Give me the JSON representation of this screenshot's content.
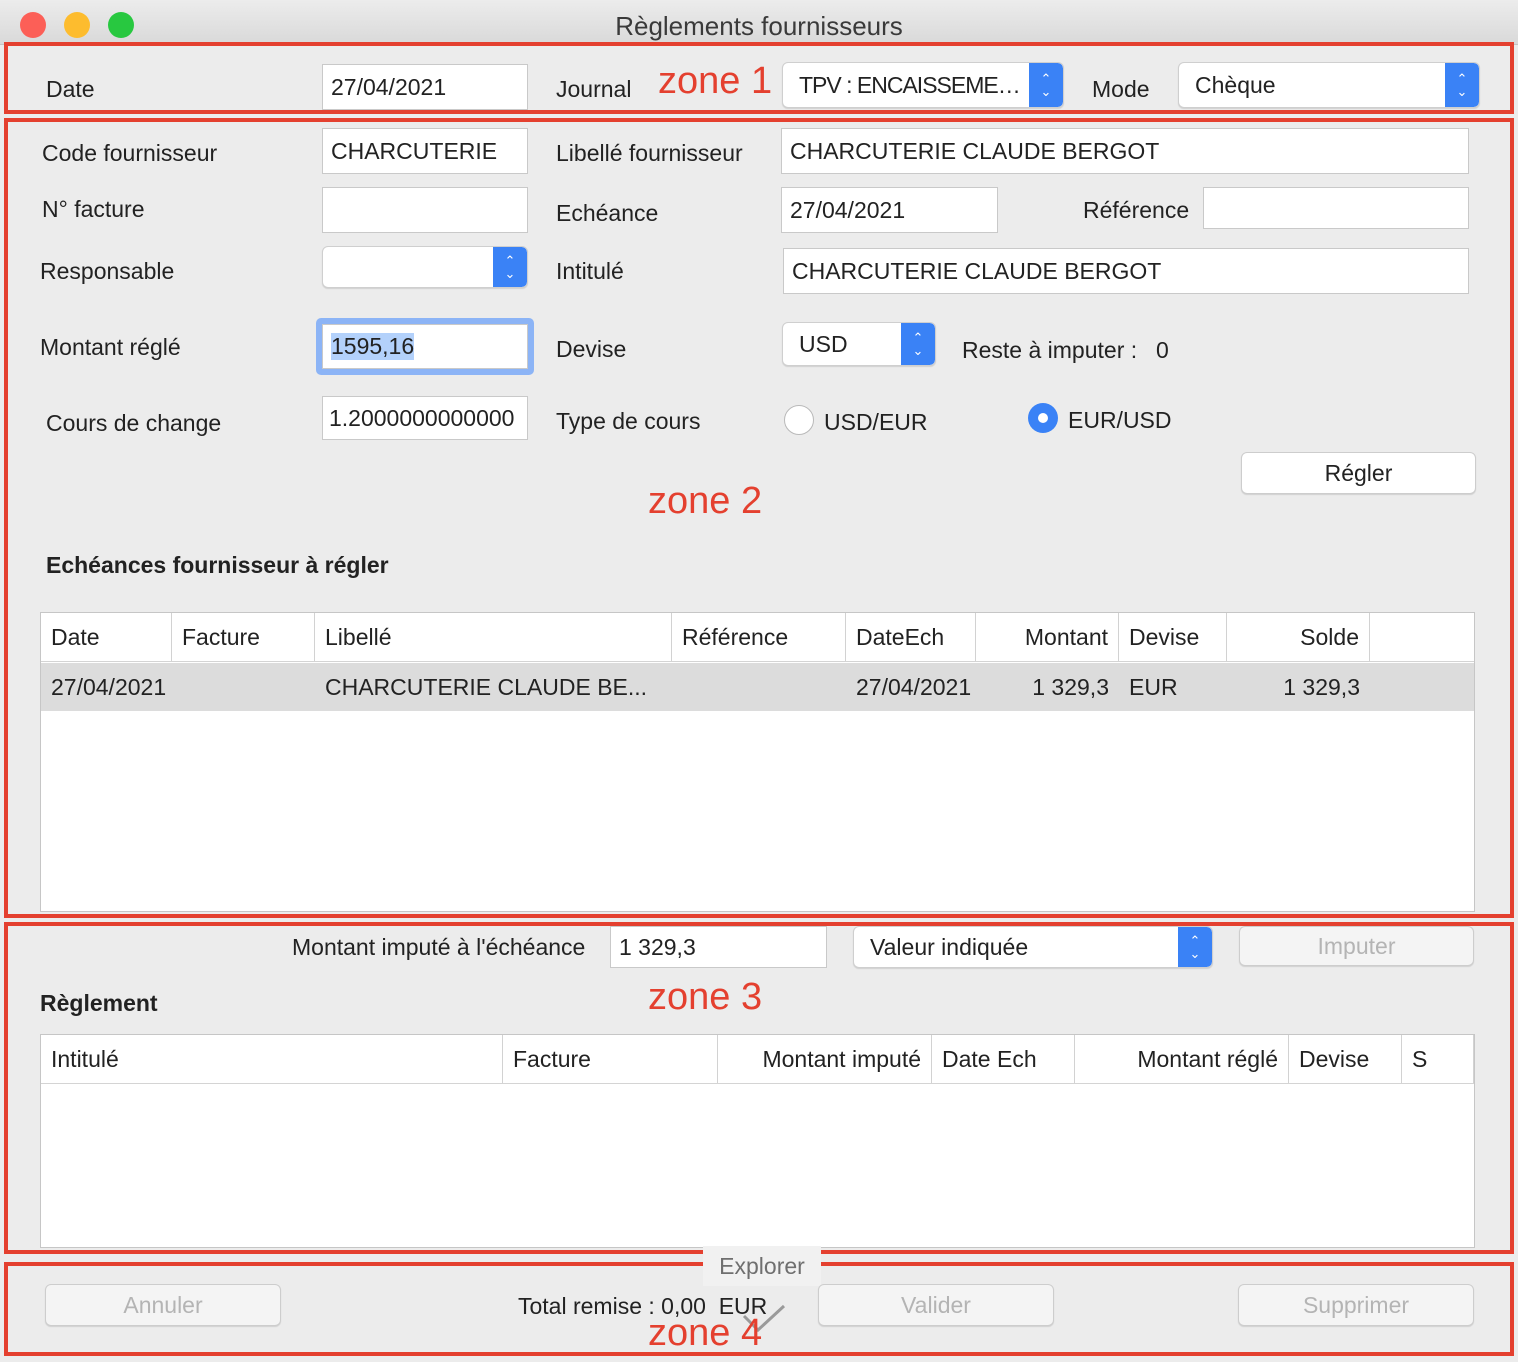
{
  "window": {
    "title": "Règlements fournisseurs",
    "traffic_lights": {
      "close": "#fc5f57",
      "minimize": "#fdbc2e",
      "zoom": "#28c840"
    }
  },
  "zone_labels": {
    "z1": "zone 1",
    "z2": "zone 2",
    "z3": "zone 3",
    "z4": "zone 4"
  },
  "accent_colors": {
    "zone_border": "#e4402f",
    "selection": "#3a82f6"
  },
  "zone1": {
    "date_label": "Date",
    "date_value": "27/04/2021",
    "journal_label": "Journal",
    "journal_value": "TPV : ENCAISSEME…",
    "mode_label": "Mode",
    "mode_value": "Chèque"
  },
  "zone2": {
    "code_label": "Code fournisseur",
    "code_value": "CHARCUTERIE",
    "libelle_label": "Libellé fournisseur",
    "libelle_value": "CHARCUTERIE CLAUDE BERGOT",
    "facture_label": "N° facture",
    "facture_value": "",
    "echeance_label": "Echéance",
    "echeance_value": "27/04/2021",
    "reference_label": "Référence",
    "reference_value": "",
    "responsable_label": "Responsable",
    "responsable_value": "",
    "intitule_label": "Intitulé",
    "intitule_value": "CHARCUTERIE CLAUDE BERGOT",
    "montant_label": "Montant réglé",
    "montant_value": "1595,16",
    "devise_label": "Devise",
    "devise_value": "USD",
    "reste_label": "Reste à imputer :",
    "reste_value": "0",
    "cours_label": "Cours de change",
    "cours_value": "1.2000000000000",
    "type_cours_label": "Type de cours",
    "radio_1": "USD/EUR",
    "radio_2": "EUR/USD",
    "selected_radio": "EUR/USD",
    "regler_button": "Régler",
    "section_title": "Echéances fournisseur à régler",
    "table": {
      "columns": [
        "Date",
        "Facture",
        "Libellé",
        "Référence",
        "DateEch",
        "Montant",
        "Devise",
        "Solde"
      ],
      "rows": [
        {
          "date": "27/04/2021",
          "facture": "",
          "libelle": "CHARCUTERIE CLAUDE BE...",
          "reference": "",
          "dateech": "27/04/2021",
          "montant": "1 329,3",
          "devise": "EUR",
          "solde": "1 329,3"
        }
      ]
    }
  },
  "zone3": {
    "montant_impute_label": "Montant imputé à l'échéance",
    "montant_impute_value": "1 329,3",
    "valeur_value": "Valeur indiquée",
    "imputer_button": "Imputer",
    "section_title": "Règlement",
    "table": {
      "columns": [
        "Intitulé",
        "Facture",
        "Montant imputé",
        "Date Ech",
        "Montant réglé",
        "Devise",
        "S"
      ],
      "rows": []
    }
  },
  "zone4": {
    "tooltip": "Explorer",
    "annuler_button": "Annuler",
    "total_text": "Total remise : 0,00  EUR",
    "valider_button": "Valider",
    "supprimer_button": "Supprimer"
  }
}
